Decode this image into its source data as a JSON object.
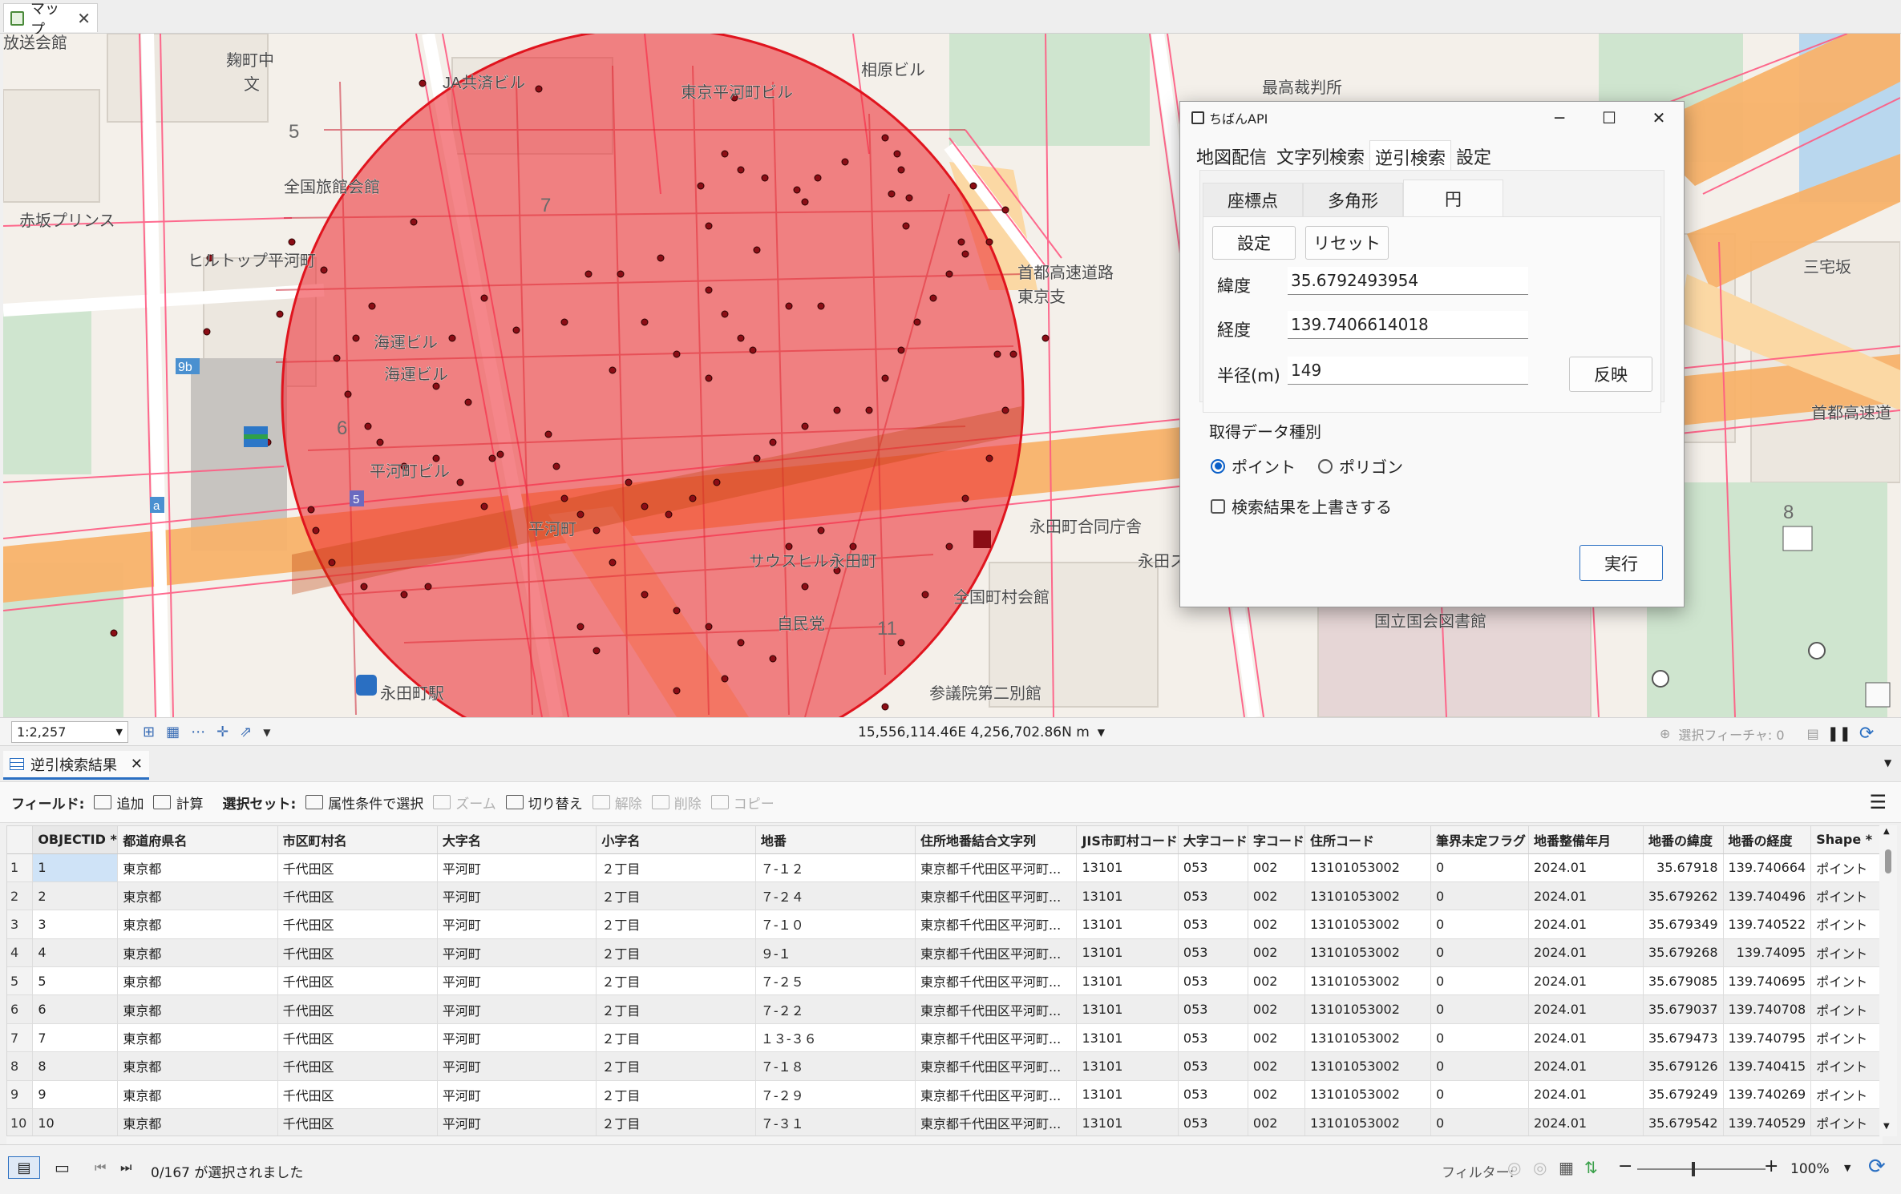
{
  "map_tab": {
    "label": "マップ"
  },
  "map": {
    "place_labels": [
      {
        "name": "pl-housou",
        "text": "放送会館"
      },
      {
        "name": "pl-kojimachi",
        "text": "麹町中"
      },
      {
        "name": "pl-bun",
        "text": "文"
      },
      {
        "name": "pl-ja",
        "text": "JA共済ビル"
      },
      {
        "name": "pl-hirakawa-bldg",
        "text": "東京平河町ビル"
      },
      {
        "name": "pl-aiohashi",
        "text": "相原ビル"
      },
      {
        "name": "pl-saikou",
        "text": "最高裁判所"
      },
      {
        "name": "pl-zenkoku-ryokan",
        "text": "全国旅館会館"
      },
      {
        "name": "pl-akasaka-prince",
        "text": "赤坂プリンス"
      },
      {
        "name": "pl-hiltop",
        "text": "ヒルトップ平河町"
      },
      {
        "name": "pl-kaiun",
        "text": "海運ビル"
      },
      {
        "name": "pl-kaiun2",
        "text": "海運ビル"
      },
      {
        "name": "pl-hirakawa-bldg2",
        "text": "平河町ビル"
      },
      {
        "name": "pl-hirakawacho",
        "text": "平河町"
      },
      {
        "name": "pl-saus",
        "text": "サウスヒル永田町"
      },
      {
        "name": "pl-jimin",
        "text": "自民党"
      },
      {
        "name": "pl-nagatacho-sta",
        "text": "永田町駅"
      },
      {
        "name": "pl-sangiin",
        "text": "参議院第二別館"
      },
      {
        "name": "pl-zenkoku-chouson",
        "text": "全国町村会館"
      },
      {
        "name": "pl-nagatacho-godo",
        "text": "永田町合同庁舎"
      },
      {
        "name": "pl-kokkai-lib",
        "text": "国立国会図書館"
      },
      {
        "name": "pl-shuto",
        "text": "首都高速道"
      },
      {
        "name": "pl-sanken",
        "text": "三宅坂"
      },
      {
        "name": "pl-shuto-kousoku",
        "text": "首都高速道路"
      },
      {
        "name": "pl-tokyo-shi",
        "text": "東京支"
      },
      {
        "name": "pl-nagata-su",
        "text": "永田スサ"
      },
      {
        "name": "pl-5a",
        "text": "5"
      },
      {
        "name": "pl-6",
        "text": "6"
      },
      {
        "name": "pl-7",
        "text": "7"
      },
      {
        "name": "pl-11",
        "text": "11"
      },
      {
        "name": "pl-8",
        "text": "8"
      },
      {
        "name": "pl-9b",
        "text": "9b"
      },
      {
        "name": "pl-a",
        "text": "a"
      },
      {
        "name": "pl-5b",
        "text": "5"
      }
    ]
  },
  "map_status": {
    "scale": "1:2,257",
    "coordinates": "15,556,114.46E 4,256,702.86N m",
    "selected_features": "選択フィーチャ: 0"
  },
  "dialog": {
    "title": "ちばんAPI",
    "tabs": [
      "地図配信",
      "文字列検索",
      "逆引検索",
      "設定"
    ],
    "active_tab": "逆引検索",
    "sub_tabs": [
      "座標点",
      "多角形",
      "円"
    ],
    "active_sub_tab": "円",
    "buttons": {
      "set": "設定",
      "reset": "リセット",
      "apply": "反映",
      "run": "実行"
    },
    "fields": {
      "lat_label": "緯度",
      "lat_value": "35.6792493954",
      "lon_label": "経度",
      "lon_value": "139.7406614018",
      "radius_label": "半径(m)",
      "radius_value": "149"
    },
    "data_type_label": "取得データ種別",
    "radio_point": "ポイント",
    "radio_polygon": "ポリゴン",
    "radio_selected": "ポイント",
    "overwrite_label": "検索結果を上書きする",
    "overwrite_checked": false
  },
  "results_tab": {
    "label": "逆引検索結果"
  },
  "toolbar": {
    "field_label": "フィールド:",
    "add": "追加",
    "calc": "計算",
    "selset_label": "選択セット:",
    "select_by_attr": "属性条件で選択",
    "zoom": "ズーム",
    "switch": "切り替え",
    "clear": "解除",
    "delete": "削除",
    "copy": "コピー"
  },
  "table": {
    "columns": [
      "OBJECTID *",
      "都道府県名",
      "市区町村名",
      "大字名",
      "小字名",
      "地番",
      "住所地番結合文字列",
      "JIS市町村コード",
      "大字コード",
      "字コード",
      "住所コード",
      "筆界未定フラグ",
      "地番整備年月",
      "地番の緯度",
      "地番の経度",
      "Shape *"
    ],
    "rows": [
      [
        "1",
        "東京都",
        "千代田区",
        "平河町",
        "２丁目",
        "７-１２",
        "東京都千代田区平河町...",
        "13101",
        "053",
        "002",
        "13101053002",
        "0",
        "2024.01",
        "35.67918",
        "139.740664",
        "ポイント"
      ],
      [
        "2",
        "東京都",
        "千代田区",
        "平河町",
        "２丁目",
        "７-２４",
        "東京都千代田区平河町...",
        "13101",
        "053",
        "002",
        "13101053002",
        "0",
        "2024.01",
        "35.679262",
        "139.740496",
        "ポイント"
      ],
      [
        "3",
        "東京都",
        "千代田区",
        "平河町",
        "２丁目",
        "７-１０",
        "東京都千代田区平河町...",
        "13101",
        "053",
        "002",
        "13101053002",
        "0",
        "2024.01",
        "35.679349",
        "139.740522",
        "ポイント"
      ],
      [
        "4",
        "東京都",
        "千代田区",
        "平河町",
        "２丁目",
        "９-１",
        "東京都千代田区平河町...",
        "13101",
        "053",
        "002",
        "13101053002",
        "0",
        "2024.01",
        "35.679268",
        "139.74095",
        "ポイント"
      ],
      [
        "5",
        "東京都",
        "千代田区",
        "平河町",
        "２丁目",
        "７-２５",
        "東京都千代田区平河町...",
        "13101",
        "053",
        "002",
        "13101053002",
        "0",
        "2024.01",
        "35.679085",
        "139.740695",
        "ポイント"
      ],
      [
        "6",
        "東京都",
        "千代田区",
        "平河町",
        "２丁目",
        "７-２２",
        "東京都千代田区平河町...",
        "13101",
        "053",
        "002",
        "13101053002",
        "0",
        "2024.01",
        "35.679037",
        "139.740708",
        "ポイント"
      ],
      [
        "7",
        "東京都",
        "千代田区",
        "平河町",
        "２丁目",
        "１３-３６",
        "東京都千代田区平河町...",
        "13101",
        "053",
        "002",
        "13101053002",
        "0",
        "2024.01",
        "35.679473",
        "139.740795",
        "ポイント"
      ],
      [
        "8",
        "東京都",
        "千代田区",
        "平河町",
        "２丁目",
        "７-１８",
        "東京都千代田区平河町...",
        "13101",
        "053",
        "002",
        "13101053002",
        "0",
        "2024.01",
        "35.679126",
        "139.740415",
        "ポイント"
      ],
      [
        "9",
        "東京都",
        "千代田区",
        "平河町",
        "２丁目",
        "７-２９",
        "東京都千代田区平河町...",
        "13101",
        "053",
        "002",
        "13101053002",
        "0",
        "2024.01",
        "35.679249",
        "139.740269",
        "ポイント"
      ],
      [
        "10",
        "東京都",
        "千代田区",
        "平河町",
        "２丁目",
        "７-３１",
        "東京都千代田区平河町...",
        "13101",
        "053",
        "002",
        "13101053002",
        "0",
        "2024.01",
        "35.679542",
        "139.740529",
        "ポイント"
      ]
    ]
  },
  "bottom_status": {
    "selection": "0/167 が選択されました",
    "filter_label": "フィルター:",
    "zoom_level": "100%"
  },
  "colors": {
    "circle_fill": "#ee2f35",
    "parcel_line": "#ff3a6a",
    "road_orange": "#f8b26a",
    "accent_blue": "#2a6fc2"
  }
}
